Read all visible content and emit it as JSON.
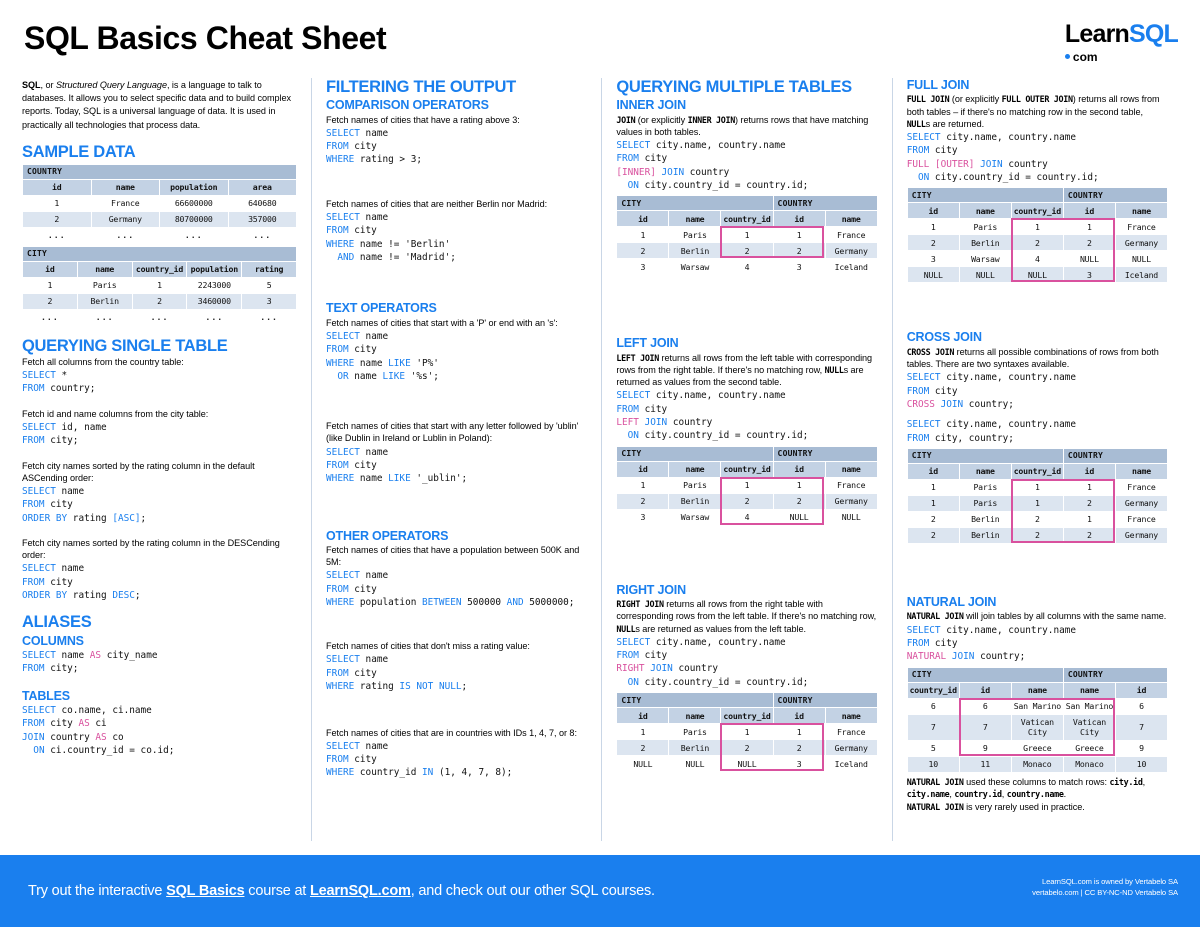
{
  "header": {
    "title": "SQL Basics Cheat Sheet",
    "logo_main_left": "Learn",
    "logo_main_right": "SQL",
    "logo_sub": "com"
  },
  "col1": {
    "intro": "SQL, or Structured Query Language, is a language to talk to databases. It allows you to select specific data and to build complex reports. Today, SQL is a universal language of data. It is used in practically all technologies that process data.",
    "intro_em": "Structured Query Language",
    "sample_data_title": "SAMPLE DATA",
    "country_table": {
      "caption": "COUNTRY",
      "columns": [
        "id",
        "name",
        "population",
        "area"
      ],
      "rows": [
        [
          "1",
          "France",
          "66600000",
          "640680"
        ],
        [
          "2",
          "Germany",
          "80700000",
          "357000"
        ],
        [
          "...",
          "...",
          "...",
          "..."
        ]
      ]
    },
    "city_table": {
      "caption": "CITY",
      "columns": [
        "id",
        "name",
        "country_id",
        "population",
        "rating"
      ],
      "rows": [
        [
          "1",
          "Paris",
          "1",
          "2243000",
          "5"
        ],
        [
          "2",
          "Berlin",
          "2",
          "3460000",
          "3"
        ],
        [
          "...",
          "...",
          "...",
          "...",
          "..."
        ]
      ]
    },
    "querying_title": "QUERYING SINGLE TABLE",
    "q1_desc": "Fetch all columns from the country table:",
    "q1_code": "SELECT *\nFROM country;",
    "q2_desc": "Fetch id and name columns from the city table:",
    "q2_code": "SELECT id, name\nFROM city;",
    "q3_desc": "Fetch city names sorted by the rating column in the default ASCending order:",
    "q3_code": "SELECT name\nFROM city\nORDER BY rating [ASC];",
    "q4_desc": "Fetch city names sorted by the rating column in the DESCending order:",
    "q4_code": "SELECT name\nFROM city\nORDER BY rating DESC;",
    "aliases_title": "ALIASES",
    "columns_title": "COLUMNS",
    "columns_code": "SELECT name AS city_name\nFROM city;",
    "tables_title": "TABLES",
    "tables_code": "SELECT co.name, ci.name\nFROM city AS ci\nJOIN country AS co\n  ON ci.country_id = co.id;"
  },
  "col2": {
    "filtering_title": "FILTERING THE OUTPUT",
    "comparison_title": "COMPARISON OPERATORS",
    "c1_desc": "Fetch names of cities that have a rating above 3:",
    "c1_code": "SELECT name\nFROM city\nWHERE rating > 3;",
    "c2_desc": "Fetch names of cities that are neither Berlin nor Madrid:",
    "c2_code": "SELECT name\nFROM city\nWHERE name != 'Berlin'\n  AND name != 'Madrid';",
    "text_title": "TEXT OPERATORS",
    "t1_desc": "Fetch names of cities that start with a 'P' or end with an 's':",
    "t1_code": "SELECT name\nFROM city\nWHERE name LIKE 'P%'\n  OR name LIKE '%s';",
    "t2_desc": "Fetch names of cities that start with any letter followed by 'ublin' (like Dublin in Ireland or Lublin in Poland):",
    "t2_code": "SELECT name\nFROM city\nWHERE name LIKE '_ublin';",
    "other_title": "OTHER OPERATORS",
    "o1_desc": "Fetch names of cities that have a population between 500K and 5M:",
    "o1_code": "SELECT name\nFROM city\nWHERE population BETWEEN 500000 AND 5000000;",
    "o2_desc": "Fetch names of cities that don't miss a rating value:",
    "o2_code": "SELECT name\nFROM city\nWHERE rating IS NOT NULL;",
    "o3_desc": "Fetch names of cities that are in countries with IDs 1, 4, 7, or 8:",
    "o3_code": "SELECT name\nFROM city\nWHERE country_id IN (1, 4, 7, 8);"
  },
  "col3": {
    "title": "QUERYING MULTIPLE TABLES",
    "inner": {
      "title": "INNER JOIN",
      "desc_pre": "JOIN",
      "desc": " (or explicitly INNER JOIN) returns rows that have matching values in both tables.",
      "code": "SELECT city.name, country.name\nFROM city\n[INNER] JOIN country\n  ON city.country_id = country.id;",
      "table": {
        "caption_left": "CITY",
        "caption_right": "COUNTRY",
        "columns": [
          "id",
          "name",
          "country_id",
          "id",
          "name"
        ],
        "rows": [
          [
            "1",
            "Paris",
            "1",
            "1",
            "France"
          ],
          [
            "2",
            "Berlin",
            "2",
            "2",
            "Germany"
          ],
          [
            "3",
            "Warsaw",
            "4",
            "3",
            "Iceland"
          ]
        ],
        "highlight_rows": 2
      }
    },
    "left": {
      "title": "LEFT JOIN",
      "desc": "LEFT JOIN returns all rows from the left table with corresponding rows from the right table. If there's no matching row, NULLs are returned as values from the second table.",
      "code": "SELECT city.name, country.name\nFROM city\nLEFT JOIN country\n  ON city.country_id = country.id;",
      "table": {
        "caption_left": "CITY",
        "caption_right": "COUNTRY",
        "columns": [
          "id",
          "name",
          "country_id",
          "id",
          "name"
        ],
        "rows": [
          [
            "1",
            "Paris",
            "1",
            "1",
            "France"
          ],
          [
            "2",
            "Berlin",
            "2",
            "2",
            "Germany"
          ],
          [
            "3",
            "Warsaw",
            "4",
            "NULL",
            "NULL"
          ]
        ],
        "highlight_rows": 3
      }
    },
    "right": {
      "title": "RIGHT JOIN",
      "desc": "RIGHT JOIN returns all rows from the right table with corresponding rows from the left table. If there's no matching row, NULLs are returned as values from the left table.",
      "code": "SELECT city.name, country.name\nFROM city\nRIGHT JOIN country\n  ON city.country_id = country.id;",
      "table": {
        "caption_left": "CITY",
        "caption_right": "COUNTRY",
        "columns": [
          "id",
          "name",
          "country_id",
          "id",
          "name"
        ],
        "rows": [
          [
            "1",
            "Paris",
            "1",
            "1",
            "France"
          ],
          [
            "2",
            "Berlin",
            "2",
            "2",
            "Germany"
          ],
          [
            "NULL",
            "NULL",
            "NULL",
            "3",
            "Iceland"
          ]
        ],
        "highlight_rows": 3
      }
    }
  },
  "col4": {
    "full": {
      "title": "FULL JOIN",
      "desc": "FULL JOIN (or explicitly FULL OUTER JOIN) returns all rows from both tables – if there's no matching row in the second table, NULLs are returned.",
      "code": "SELECT city.name, country.name\nFROM city\nFULL [OUTER] JOIN country\n  ON city.country_id = country.id;",
      "table": {
        "caption_left": "CITY",
        "caption_right": "COUNTRY",
        "columns": [
          "id",
          "name",
          "country_id",
          "id",
          "name"
        ],
        "rows": [
          [
            "1",
            "Paris",
            "1",
            "1",
            "France"
          ],
          [
            "2",
            "Berlin",
            "2",
            "2",
            "Germany"
          ],
          [
            "3",
            "Warsaw",
            "4",
            "NULL",
            "NULL"
          ],
          [
            "NULL",
            "NULL",
            "NULL",
            "3",
            "Iceland"
          ]
        ],
        "highlight_rows": 4
      }
    },
    "cross": {
      "title": "CROSS JOIN",
      "desc": "CROSS JOIN returns all possible combinations of rows from both tables. There are two syntaxes available.",
      "code1": "SELECT city.name, country.name\nFROM city\nCROSS JOIN country;",
      "code2": "SELECT city.name, country.name\nFROM city, country;",
      "table": {
        "caption_left": "CITY",
        "caption_right": "COUNTRY",
        "columns": [
          "id",
          "name",
          "country_id",
          "id",
          "name"
        ],
        "rows": [
          [
            "1",
            "Paris",
            "1",
            "1",
            "France"
          ],
          [
            "1",
            "Paris",
            "1",
            "2",
            "Germany"
          ],
          [
            "2",
            "Berlin",
            "2",
            "1",
            "France"
          ],
          [
            "2",
            "Berlin",
            "2",
            "2",
            "Germany"
          ]
        ],
        "highlight_rows": 4
      }
    },
    "natural": {
      "title": "NATURAL JOIN",
      "desc": "NATURAL JOIN will join tables by all columns with the same name.",
      "code": "SELECT city.name, country.name\nFROM city\nNATURAL JOIN country;",
      "table": {
        "caption_left": "CITY",
        "caption_right": "COUNTRY",
        "columns": [
          "country_id",
          "id",
          "name",
          "name",
          "id"
        ],
        "rows": [
          [
            "6",
            "6",
            "San Marino",
            "San Marino",
            "6"
          ],
          [
            "7",
            "7",
            "Vatican City",
            "Vatican City",
            "7"
          ],
          [
            "5",
            "9",
            "Greece",
            "Greece",
            "9"
          ],
          [
            "10",
            "11",
            "Monaco",
            "Monaco",
            "10"
          ]
        ],
        "highlight_rows": 3
      },
      "note1": "NATURAL JOIN used these columns to match rows: city.id, city.name, country.id, country.name.",
      "note2": "NATURAL JOIN is very rarely used in practice."
    }
  },
  "footer": {
    "text_a": "Try out the interactive ",
    "link_1": "SQL Basics",
    "text_b": " course at ",
    "link_2": "LearnSQL.com",
    "text_c": ", and check out our other SQL courses.",
    "right_line1": "LearnSQL.com is owned by Vertabelo SA",
    "right_line2": "vertabelo.com | CC BY-NC-ND Vertabelo SA"
  },
  "colors": {
    "accent": "#1a7fee",
    "pink": "#d9519e",
    "table_caption": "#a8bcd4",
    "table_header": "#c3d2e4",
    "table_row_alt": "#dce5f0"
  }
}
